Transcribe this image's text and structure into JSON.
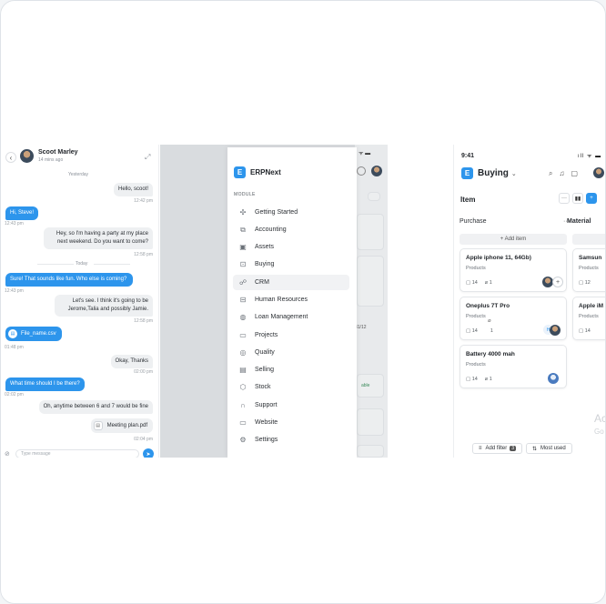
{
  "chat": {
    "name": "Scoot Marley",
    "status": "14 mins ago",
    "day_yesterday": "Yesterday",
    "day_today": "Today",
    "composer_placeholder": "Type message",
    "messages": [
      {
        "side": "right",
        "text": "Hello, scoot!",
        "time": "12:42 pm"
      },
      {
        "side": "left",
        "text": "Hi, Steve!",
        "time": "12:43 pm"
      },
      {
        "side": "right",
        "text": "Hey, so I'm having a party at my place next weekend. Do you want to come?",
        "time": "12:58 pm"
      },
      {
        "side": "left",
        "text": "Sure! That sounds like fun. Who else is coming?",
        "time": "12:43 pm"
      },
      {
        "side": "right",
        "text": "Let's see. I think it's going to be Jerome,Talia and possibly Jamie.",
        "time": "12:58 pm"
      },
      {
        "side": "left",
        "text": "File_name.csv",
        "time": "01:48 pm"
      },
      {
        "side": "right",
        "text": "Okay, Thanks",
        "time": "02:00 pm"
      },
      {
        "side": "left",
        "text": "What time should I be there?",
        "time": "02:02 pm"
      },
      {
        "side": "right",
        "text": "Oh, anytime between 6 and 7 would be fine",
        "time": ""
      },
      {
        "side": "right",
        "text": "Meeting plan.pdf",
        "time": "02:04 pm"
      }
    ]
  },
  "drawer": {
    "app_name": "ERPNext",
    "logo_letter": "E",
    "module_label": "MODULE",
    "items": [
      {
        "label": "Getting Started",
        "icon": "puzzle-icon"
      },
      {
        "label": "Accounting",
        "icon": "accounting-icon"
      },
      {
        "label": "Assets",
        "icon": "assets-icon"
      },
      {
        "label": "Buying",
        "icon": "cart-icon"
      },
      {
        "label": "CRM",
        "icon": "crm-icon"
      },
      {
        "label": "Human Resources",
        "icon": "hr-icon"
      },
      {
        "label": "Loan Management",
        "icon": "loan-icon"
      },
      {
        "label": "Projects",
        "icon": "folder-icon"
      },
      {
        "label": "Quality",
        "icon": "quality-icon"
      },
      {
        "label": "Selling",
        "icon": "selling-icon"
      },
      {
        "label": "Stock",
        "icon": "stock-icon"
      },
      {
        "label": "Support",
        "icon": "headset-icon"
      },
      {
        "label": "Website",
        "icon": "website-icon"
      },
      {
        "label": "Settings",
        "icon": "settings-icon"
      }
    ],
    "active_index": 4,
    "bg_snippets": {
      "date": "31/12",
      "tag": "able"
    }
  },
  "phone": {
    "time": "9:41",
    "title": "Buying",
    "logo_letter": "E",
    "section": "Item",
    "columns": [
      {
        "title": "Purchase",
        "add_label": "+ Add item"
      },
      {
        "title": "Material"
      }
    ],
    "cards": [
      {
        "title": "Apple iphone 11, 64Gb)",
        "sub": "Products",
        "comments": "14",
        "attachments": "1"
      },
      {
        "title": "Oneplus 7T Pro",
        "sub": "Products",
        "comments": "14",
        "attachments": "1"
      },
      {
        "title": "Battery 4000 mah",
        "sub": "Products",
        "comments": "14",
        "attachments": "1"
      }
    ],
    "partial_cards": [
      {
        "title": "Samsun",
        "sub": "Products",
        "comments": "12"
      },
      {
        "title": "Apple iM",
        "sub": "Products",
        "comments": "14"
      }
    ],
    "filter_label": "Add filter",
    "filter_count": "3",
    "sort_label": "Most used",
    "watermark": "Ac",
    "watermark2": "Go"
  },
  "colors": {
    "accent": "#2d95ec"
  }
}
